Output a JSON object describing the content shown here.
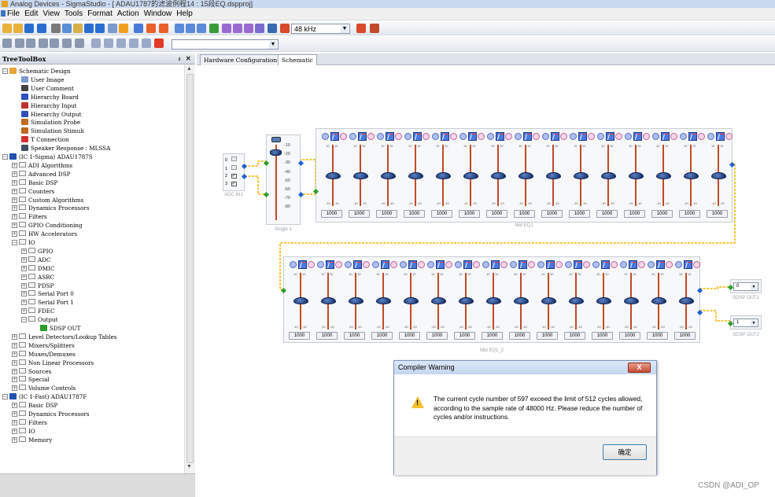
{
  "window": {
    "title": "Analog Devices - SigmaStudio - [ ADAU1787的滤波例程14 : 15段EQ.dspproj]"
  },
  "menu": {
    "items": [
      "File",
      "Edit",
      "View",
      "Tools",
      "Format",
      "Action",
      "Window",
      "Help"
    ]
  },
  "toolbar": {
    "sample_rate": "48 kHz"
  },
  "treebox": {
    "title": "TreeToolBox",
    "pin": "♯",
    "close": "×",
    "items": [
      {
        "label": "Schematic Design",
        "depth": 0,
        "exp": "−",
        "color": "#e9a43a"
      },
      {
        "label": "User Image",
        "depth": 2,
        "exp": "",
        "color": "#7f9bcf"
      },
      {
        "label": "User Comment",
        "depth": 2,
        "exp": "",
        "color": "#444444"
      },
      {
        "label": "Hierarchy Board",
        "depth": 2,
        "exp": "",
        "color": "#3050c0"
      },
      {
        "label": "Hierarchy Input",
        "depth": 2,
        "exp": "",
        "color": "#c03030"
      },
      {
        "label": "Hierarchy Output",
        "depth": 2,
        "exp": "",
        "color": "#3050c0"
      },
      {
        "label": "Simulation Probe",
        "depth": 2,
        "exp": "",
        "color": "#c06a20"
      },
      {
        "label": "Simulation Stimuli",
        "depth": 2,
        "exp": "",
        "color": "#c06a20"
      },
      {
        "label": "T Connection",
        "depth": 2,
        "exp": "",
        "color": "#d03030"
      },
      {
        "label": "Speaker Response : MLSSA",
        "depth": 2,
        "exp": "",
        "color": "#405060"
      },
      {
        "label": "(IC 1-Sigma) ADAU1787S",
        "depth": 0,
        "exp": "−",
        "color": "#2050b0"
      },
      {
        "label": "ADI Algorithms",
        "depth": 1,
        "exp": "+",
        "color": ""
      },
      {
        "label": "Advanced DSP",
        "depth": 1,
        "exp": "+",
        "color": ""
      },
      {
        "label": "Basic DSP",
        "depth": 1,
        "exp": "+",
        "color": ""
      },
      {
        "label": "Counters",
        "depth": 1,
        "exp": "+",
        "color": ""
      },
      {
        "label": "Custom Algorithms",
        "depth": 1,
        "exp": "+",
        "color": ""
      },
      {
        "label": "Dynamics Processors",
        "depth": 1,
        "exp": "+",
        "color": ""
      },
      {
        "label": "Filters",
        "depth": 1,
        "exp": "+",
        "color": ""
      },
      {
        "label": "GPIO Conditioning",
        "depth": 1,
        "exp": "+",
        "color": ""
      },
      {
        "label": "HW Accelerators",
        "depth": 1,
        "exp": "+",
        "color": ""
      },
      {
        "label": "IO",
        "depth": 1,
        "exp": "−",
        "color": ""
      },
      {
        "label": "GPIO",
        "depth": 2,
        "exp": "+",
        "color": ""
      },
      {
        "label": "ADC",
        "depth": 2,
        "exp": "+",
        "color": ""
      },
      {
        "label": "DMIC",
        "depth": 2,
        "exp": "+",
        "color": ""
      },
      {
        "label": "ASRC",
        "depth": 2,
        "exp": "+",
        "color": ""
      },
      {
        "label": "PDSP",
        "depth": 2,
        "exp": "+",
        "color": ""
      },
      {
        "label": "Serial Port 0",
        "depth": 2,
        "exp": "+",
        "color": ""
      },
      {
        "label": "Serial Port 1",
        "depth": 2,
        "exp": "+",
        "color": ""
      },
      {
        "label": "FDEC",
        "depth": 2,
        "exp": "+",
        "color": ""
      },
      {
        "label": "Output",
        "depth": 2,
        "exp": "−",
        "color": ""
      },
      {
        "label": "SDSP OUT",
        "depth": 4,
        "exp": "",
        "color": "#2a9d2a"
      },
      {
        "label": "Level Detectors/Lookup Tables",
        "depth": 1,
        "exp": "+",
        "color": ""
      },
      {
        "label": "Mixers/Splitters",
        "depth": 1,
        "exp": "+",
        "color": ""
      },
      {
        "label": "Muxes/Demuxes",
        "depth": 1,
        "exp": "+",
        "color": ""
      },
      {
        "label": "Non Linear Processors",
        "depth": 1,
        "exp": "+",
        "color": ""
      },
      {
        "label": "Sources",
        "depth": 1,
        "exp": "+",
        "color": ""
      },
      {
        "label": "Special",
        "depth": 1,
        "exp": "+",
        "color": ""
      },
      {
        "label": "Volume Controls",
        "depth": 1,
        "exp": "+",
        "color": ""
      },
      {
        "label": "(IC 1-Fast) ADAU1787F",
        "depth": 0,
        "exp": "−",
        "color": "#2050b0"
      },
      {
        "label": "Basic DSP",
        "depth": 1,
        "exp": "+",
        "color": ""
      },
      {
        "label": "Dynamics Processors",
        "depth": 1,
        "exp": "+",
        "color": ""
      },
      {
        "label": "Filters",
        "depth": 1,
        "exp": "+",
        "color": ""
      },
      {
        "label": "IO",
        "depth": 1,
        "exp": "+",
        "color": ""
      },
      {
        "label": "Memory",
        "depth": 1,
        "exp": "+",
        "color": ""
      }
    ]
  },
  "tabs": [
    {
      "label": "Hardware Configuration"
    },
    {
      "label": "Schematic"
    }
  ],
  "schematic": {
    "adc_block": {
      "label": "ADC IN1",
      "rows": [
        "0",
        "1",
        "2",
        "3"
      ]
    },
    "single_block": {
      "label": "Single 1",
      "ticks": [
        "-10",
        "-20",
        "-30",
        "-40",
        "-50",
        "-60",
        "-70",
        "-80"
      ]
    },
    "eq1": {
      "label": "Mid EQ1",
      "values": [
        "1000",
        "1000",
        "1000",
        "1000",
        "1000",
        "1000",
        "1000",
        "1000",
        "1000",
        "1000",
        "1000",
        "1000",
        "1000",
        "1000",
        "1000"
      ],
      "scale_top": "10",
      "scale_bottom": "-10"
    },
    "eq2": {
      "label": "Mid EQ1_2",
      "values": [
        "1000",
        "1000",
        "1000",
        "1000",
        "1000",
        "1000",
        "1000",
        "1000",
        "1000",
        "1000",
        "1000",
        "1000",
        "1000",
        "1000",
        "1000"
      ],
      "scale_top": "10",
      "scale_bottom": "-10"
    },
    "out1": {
      "label": "SDSP OUT1",
      "value": "0"
    },
    "out2": {
      "label": "SDSP OUT2",
      "value": "1"
    }
  },
  "dialog": {
    "title": "Compiler Warning",
    "message": "The current cycle number of 597 exceed the limit of 512 cycles allowed, according to the sample rate of 48000 Hz. Please reduce the number of cycles and/or instructions.",
    "ok": "确定",
    "close_glyph": "X",
    "warn_glyph": "!"
  },
  "watermark": "CSDN @ADI_OP"
}
